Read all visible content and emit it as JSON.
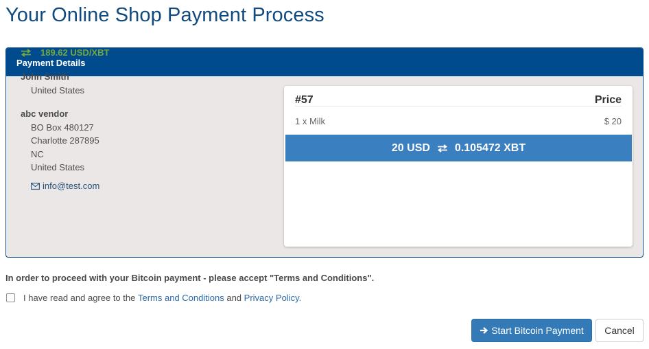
{
  "page": {
    "title": "Your Online Shop Payment Process"
  },
  "panel": {
    "heading": "Payment Details",
    "rate": "189.62 USD/XBT",
    "buyer": {
      "name": "John Smith",
      "country": "United States"
    },
    "vendor": {
      "name": "abc vendor",
      "address_lines": [
        "BO Box 480127",
        "Charlotte 287895",
        "NC",
        "United States"
      ],
      "email": "info@test.com"
    }
  },
  "cart": {
    "order_id": "#57",
    "price_header": "Price",
    "items": [
      {
        "name": "1 x Milk",
        "price": "$ 20"
      }
    ],
    "total_usd": "20 USD",
    "total_xbt": "0.105472 XBT"
  },
  "terms": {
    "notice": "In order to proceed with your Bitcoin payment - please accept \"Terms and Conditions\".",
    "agree_prefix": "I have read and agree to the",
    "terms_link": "Terms and Conditions",
    "and_text": "and",
    "privacy_link": "Privacy Policy.",
    "checked": false
  },
  "actions": {
    "start_label": "Start Bitcoin Payment",
    "cancel_label": "Cancel"
  },
  "colors": {
    "brand_blue": "#004b8d",
    "title_blue": "#104a7e",
    "rate_green": "#74a83f",
    "button_blue": "#337ab7",
    "total_bar_blue": "#3a7fc0",
    "panel_bg": "#ebe7e6"
  },
  "icons": {
    "rate": "swap-arrows-icon",
    "email": "envelope-icon",
    "total": "swap-arrows-icon",
    "start": "arrow-right-icon"
  }
}
